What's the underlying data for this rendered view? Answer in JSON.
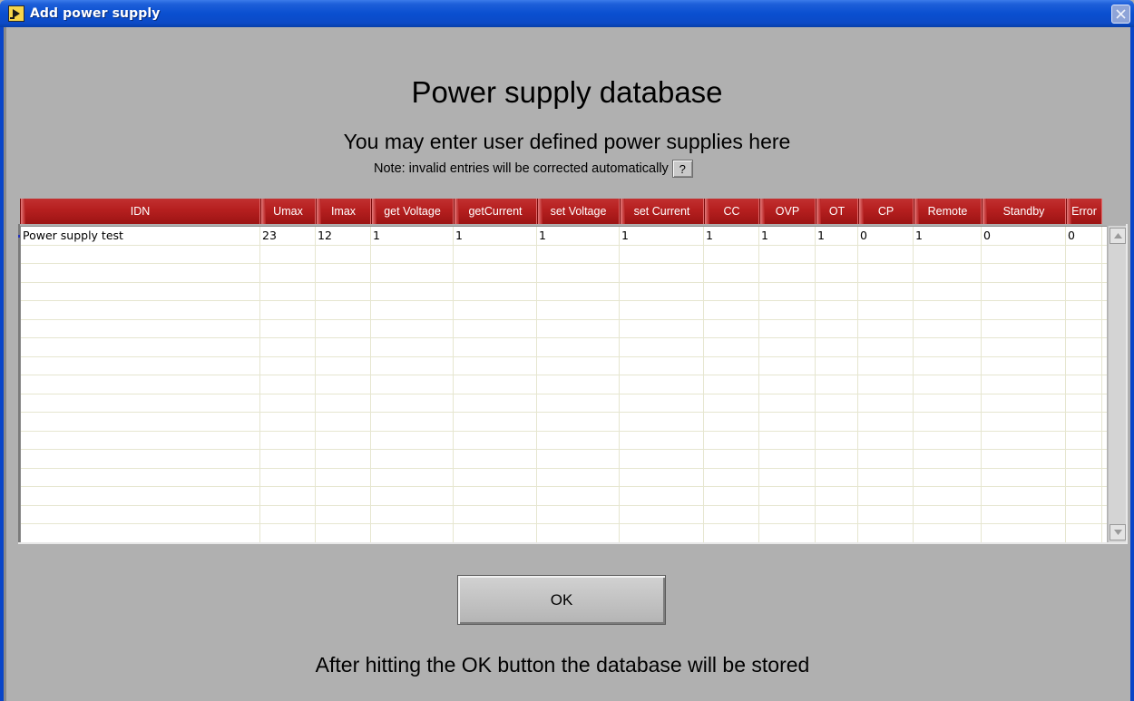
{
  "window": {
    "title": "Add power supply",
    "icon": "labview-run-icon",
    "close_icon": "close-icon"
  },
  "main": {
    "title": "Power supply database",
    "subtitle": "You may enter user defined power supplies here",
    "note": "Note: invalid entries will be corrected automatically",
    "help_label": "?"
  },
  "table": {
    "columns": [
      {
        "label": "IDN"
      },
      {
        "label": "Umax"
      },
      {
        "label": "Imax"
      },
      {
        "label": "get Voltage"
      },
      {
        "label": "getCurrent"
      },
      {
        "label": "set Voltage"
      },
      {
        "label": "set Current"
      },
      {
        "label": "CC"
      },
      {
        "label": "OVP"
      },
      {
        "label": "OT"
      },
      {
        "label": "CP"
      },
      {
        "label": "Remote"
      },
      {
        "label": "Standby"
      },
      {
        "label": "Error"
      }
    ],
    "rows": [
      [
        "Power supply test",
        "23",
        "12",
        "1",
        "1",
        "1",
        "1",
        "1",
        "1",
        "1",
        "0",
        "1",
        "0",
        "0"
      ]
    ],
    "empty_rows": 16
  },
  "ok_button": {
    "label": "OK"
  },
  "footer": {
    "text": "After hitting the OK button the database will be stored"
  },
  "colors": {
    "header_red": "#b51f1f",
    "background": "#b0b0b0",
    "titlebar_blue": "#0a4fd0"
  }
}
